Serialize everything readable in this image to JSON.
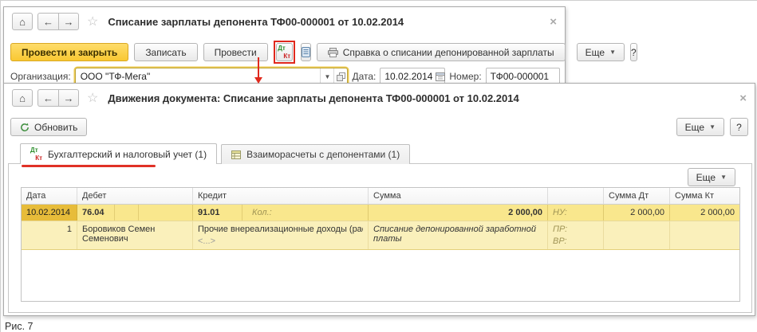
{
  "ui": {
    "home_icon": "⌂",
    "back_icon": "←",
    "forward_icon": "→",
    "favorite_icon": "☆",
    "close_icon": "×",
    "dropdown_arrow": "▼",
    "dt": "Дт",
    "kt": "Кт"
  },
  "colors": {
    "primary_button_yellow": "#f9c832",
    "row_highlight": "#f9e78d",
    "row_highlight_light": "#faf0bb",
    "selected_cell_gold": "#e7bc3a",
    "annotation_red": "#e0291d"
  },
  "doc_window": {
    "title": "Списание зарплаты депонента ТФ00-000001 от 10.02.2014",
    "toolbar": {
      "post_and_close_label": "Провести и закрыть",
      "save_label": "Записать",
      "post_label": "Провести",
      "reference_label": "Справка о списании депонированной зарплаты",
      "more_label": "Еще",
      "help_label": "?"
    },
    "form": {
      "organization_label": "Организация:",
      "organization_value": "ООО \"ТФ-Мега\"",
      "date_label": "Дата:",
      "date_value": "10.02.2014",
      "number_label": "Номер:",
      "number_value": "ТФ00-000001"
    }
  },
  "movements_window": {
    "title": "Движения документа: Списание зарплаты депонента ТФ00-000001 от 10.02.2014",
    "refresh_label": "Обновить",
    "more_label": "Еще",
    "help_label": "?",
    "panel_more_label": "Еще",
    "tabs": [
      {
        "label": "Бухгалтерский и налоговый учет (1)"
      },
      {
        "label": "Взаиморасчеты с депонентами (1)"
      }
    ],
    "table": {
      "headers": {
        "date": "Дата",
        "debit": "Дебет",
        "credit": "Кредит",
        "amount": "Сумма",
        "aux": "",
        "amount_dt": "Сумма Дт",
        "amount_kt": "Сумма Кт"
      },
      "entry": {
        "date": "10.02.2014",
        "line_no": "1",
        "debit_account": "76.04",
        "debit_analytics": "Боровиков Семен Семенович",
        "credit_account": "91.01",
        "credit_analytics": "Прочие внереализационные доходы (расходы)",
        "credit_subconto_empty": "<...>",
        "qty_label": "Кол.:",
        "amount": "2 000,00",
        "description": "Списание депонированной заработной платы",
        "nu_label": "НУ:",
        "pr_label": "ПР:",
        "vr_label": "ВР:",
        "amount_dt": "2 000,00",
        "amount_kt": "2 000,00"
      }
    }
  },
  "caption": "Рис. 7"
}
